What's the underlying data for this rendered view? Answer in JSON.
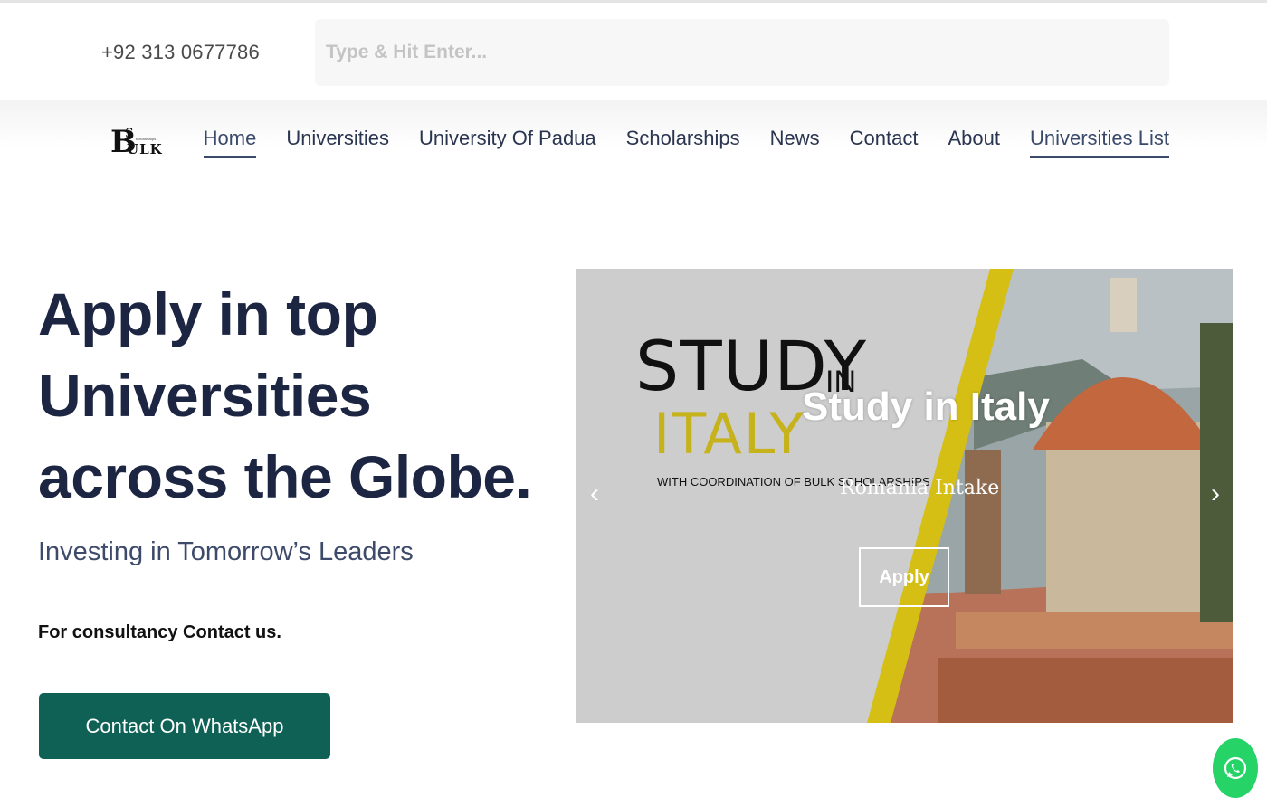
{
  "topbar": {
    "phone": "+92 313 0677786",
    "search_placeholder": "Type & Hit Enter...",
    "search_value": ""
  },
  "logo": {
    "big": "B",
    "s": "S",
    "ulk": "ULK",
    "tiny": "scholarships"
  },
  "nav": {
    "items": [
      {
        "label": "Home",
        "active": true
      },
      {
        "label": "Universities"
      },
      {
        "label": "University Of Padua"
      },
      {
        "label": "Scholarships"
      },
      {
        "label": "News"
      },
      {
        "label": "Contact"
      },
      {
        "label": "About"
      },
      {
        "label": "Universities List",
        "active": true
      }
    ]
  },
  "hero": {
    "title": "Apply in top Universities across the Globe.",
    "subtitle": "Investing in Tomorrow’s Leaders",
    "consult_text": "For consultancy Contact us.",
    "whatsapp_button": "Contact On WhatsApp"
  },
  "slider": {
    "logo_study": "STUDY",
    "logo_in": "IN",
    "logo_italy": "ITALY",
    "logo_coordination": "WITH COORDINATION OF BULK SCHOLARSHIPS",
    "slide_title": "Study in Italy",
    "slide_subtitle": "Romania Intake",
    "apply_button": "Apply",
    "prev_arrow": "‹",
    "next_arrow": "›"
  },
  "colors": {
    "primary_dark": "#1c2541",
    "whatsapp_button": "#0f6155",
    "whatsapp_float": "#25d366",
    "italy_yellow": "#c6b21a"
  },
  "icons": {
    "whatsapp_float": "whatsapp-icon",
    "prev": "chevron-left-icon",
    "next": "chevron-right-icon"
  }
}
